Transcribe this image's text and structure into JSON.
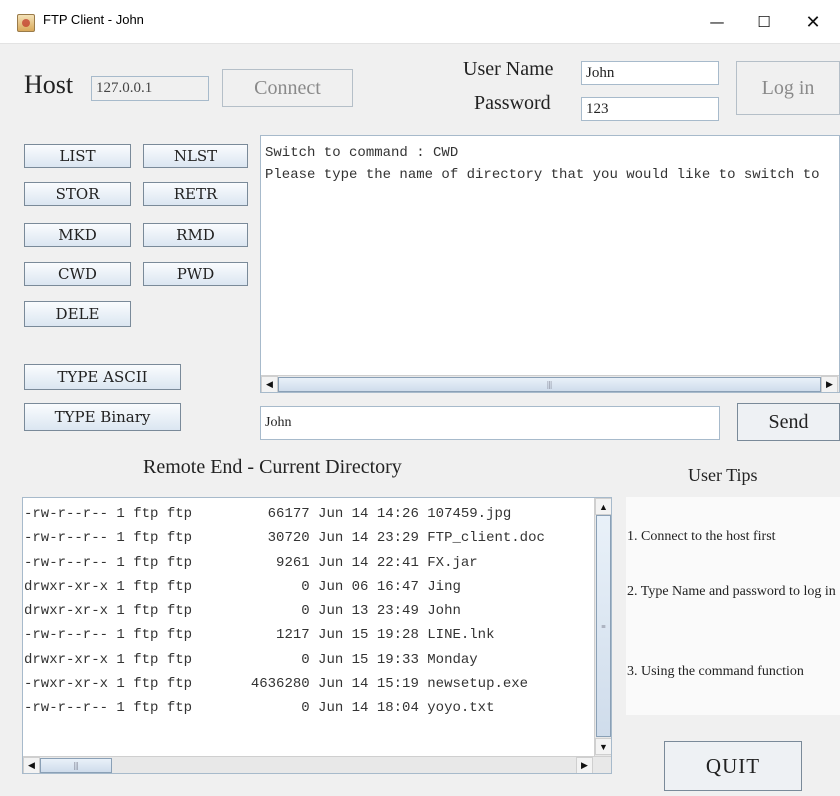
{
  "window": {
    "title": "FTP Client - John",
    "minimize_glyph": "—",
    "maximize_glyph": "☐",
    "close_glyph": "✕"
  },
  "connection": {
    "host_label": "Host",
    "host_value": "127.0.0.1",
    "connect_label": "Connect",
    "username_label": "User Name",
    "username_value": "John",
    "password_label": "Password",
    "password_value": "123",
    "login_label": "Log in"
  },
  "commands": {
    "list": "LIST",
    "nlst": "NLST",
    "stor": "STOR",
    "retr": "RETR",
    "mkd": "MKD",
    "rmd": "RMD",
    "cwd": "CWD",
    "pwd": "PWD",
    "dele": "DELE",
    "type_ascii": "TYPE ASCII",
    "type_binary": "TYPE Binary"
  },
  "console": {
    "lines": [
      "Switch to command : CWD",
      "Please type the name of directory that you would like to switch to"
    ]
  },
  "input": {
    "value": "John",
    "send_label": "Send"
  },
  "remote": {
    "title": "Remote End - Current Directory",
    "files": [
      "-rw-r--r-- 1 ftp ftp         66177 Jun 14 14:26 107459.jpg",
      "-rw-r--r-- 1 ftp ftp         30720 Jun 14 23:29 FTP_client.doc",
      "-rw-r--r-- 1 ftp ftp          9261 Jun 14 22:41 FX.jar",
      "drwxr-xr-x 1 ftp ftp             0 Jun 06 16:47 Jing",
      "drwxr-xr-x 1 ftp ftp             0 Jun 13 23:49 John",
      "-rw-r--r-- 1 ftp ftp          1217 Jun 15 19:28 LINE.lnk",
      "drwxr-xr-x 1 ftp ftp             0 Jun 15 19:33 Monday",
      "-rwxr-xr-x 1 ftp ftp       4636280 Jun 14 15:19 newsetup.exe",
      "-rw-r--r-- 1 ftp ftp             0 Jun 14 18:04 yoyo.txt"
    ]
  },
  "tips": {
    "title": "User Tips",
    "items": [
      "1. Connect to the host first",
      "2. Type Name and password to log in",
      "3. Using the command function"
    ]
  },
  "quit_label": "QUIT",
  "icons": {
    "app": "java-cup-icon",
    "scroll_left": "◀",
    "scroll_right": "▶",
    "scroll_up": "▲",
    "scroll_down": "▼",
    "grip_h": "|||",
    "grip_v": "≡"
  }
}
